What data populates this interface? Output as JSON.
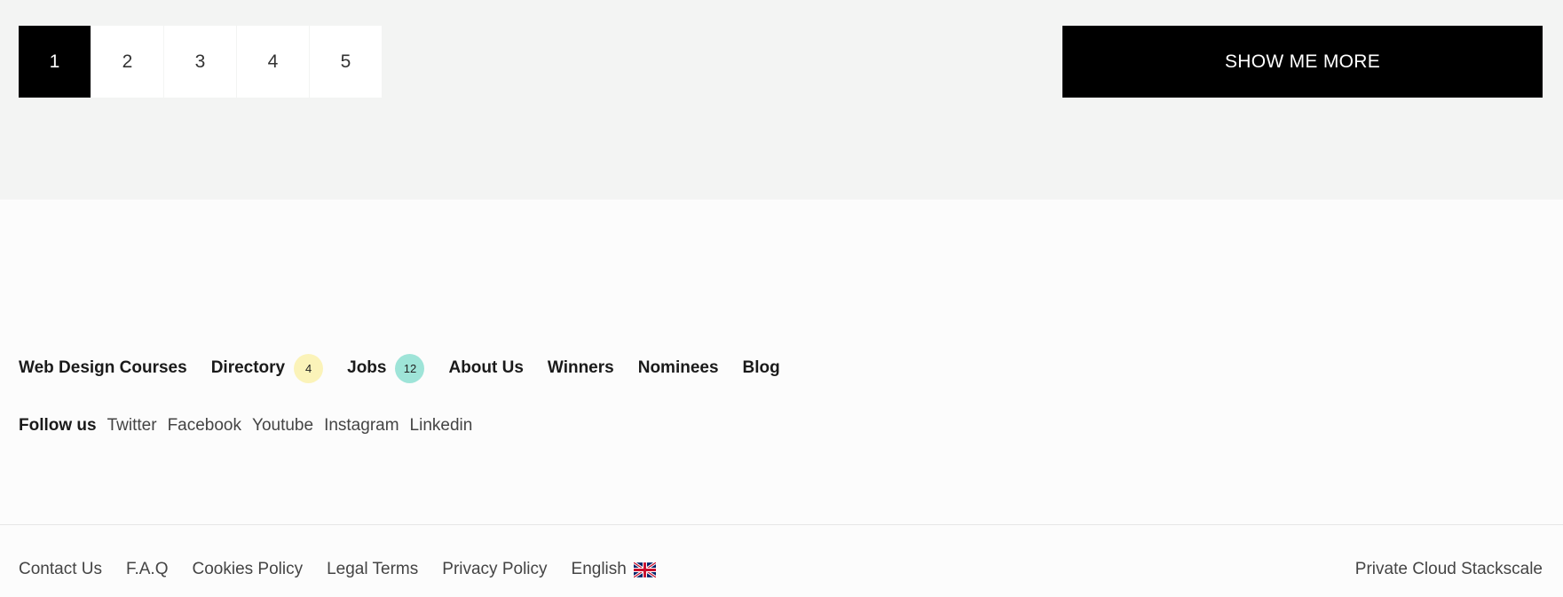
{
  "pagination": {
    "pages": [
      "1",
      "2",
      "3",
      "4",
      "5"
    ],
    "active_page": "1"
  },
  "show_more": {
    "label": "SHOW ME MORE"
  },
  "footer_nav": {
    "items": [
      {
        "label": "Web Design Courses"
      },
      {
        "label": "Directory",
        "badge": "4",
        "badge_color": "#fbf3b9"
      },
      {
        "label": "Jobs",
        "badge": "12",
        "badge_color": "#9ee4d8"
      },
      {
        "label": "About Us"
      },
      {
        "label": "Winners"
      },
      {
        "label": "Nominees"
      },
      {
        "label": "Blog"
      }
    ]
  },
  "follow": {
    "label": "Follow us",
    "links": [
      "Twitter",
      "Facebook",
      "Youtube",
      "Instagram",
      "Linkedin"
    ]
  },
  "bottom": {
    "links": [
      "Contact Us",
      "F.A.Q",
      "Cookies Policy",
      "Legal Terms",
      "Privacy Policy"
    ],
    "language": "English",
    "language_icon": "uk-flag-icon",
    "credit": "Private Cloud Stackscale"
  },
  "colors": {
    "accent_black": "#000000",
    "band_background": "#f3f4f3",
    "badge_yellow": "#fbf3b9",
    "badge_teal": "#9ee4d8"
  }
}
